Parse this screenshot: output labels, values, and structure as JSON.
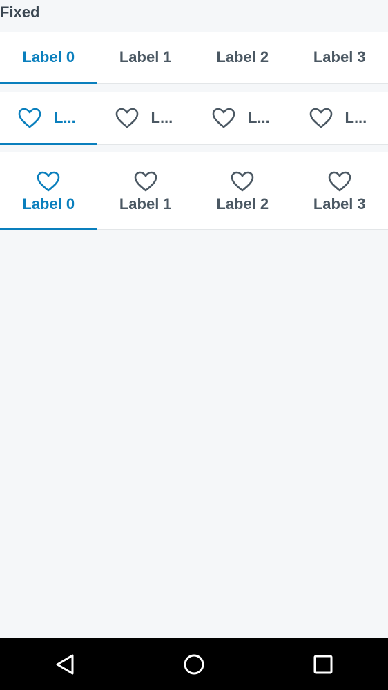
{
  "section_title": "Fixed",
  "colors": {
    "accent": "#0a7fbd",
    "text": "#4b5863",
    "background": "#f5f7f9"
  },
  "text_tabs": {
    "selected_index": 0,
    "items": [
      {
        "label": "Label 0"
      },
      {
        "label": "Label 1"
      },
      {
        "label": "Label 2"
      },
      {
        "label": "Label 3"
      }
    ]
  },
  "inline_icon_tabs": {
    "selected_index": 0,
    "icon": "heart-icon",
    "items": [
      {
        "label": "L..."
      },
      {
        "label": "L..."
      },
      {
        "label": "L..."
      },
      {
        "label": "L..."
      }
    ]
  },
  "stacked_icon_tabs": {
    "selected_index": 0,
    "icon": "heart-icon",
    "items": [
      {
        "label": "Label 0"
      },
      {
        "label": "Label 1"
      },
      {
        "label": "Label 2"
      },
      {
        "label": "Label 3"
      }
    ]
  },
  "navigation_bar": {
    "buttons": [
      "back-icon",
      "home-icon",
      "recents-icon"
    ]
  }
}
